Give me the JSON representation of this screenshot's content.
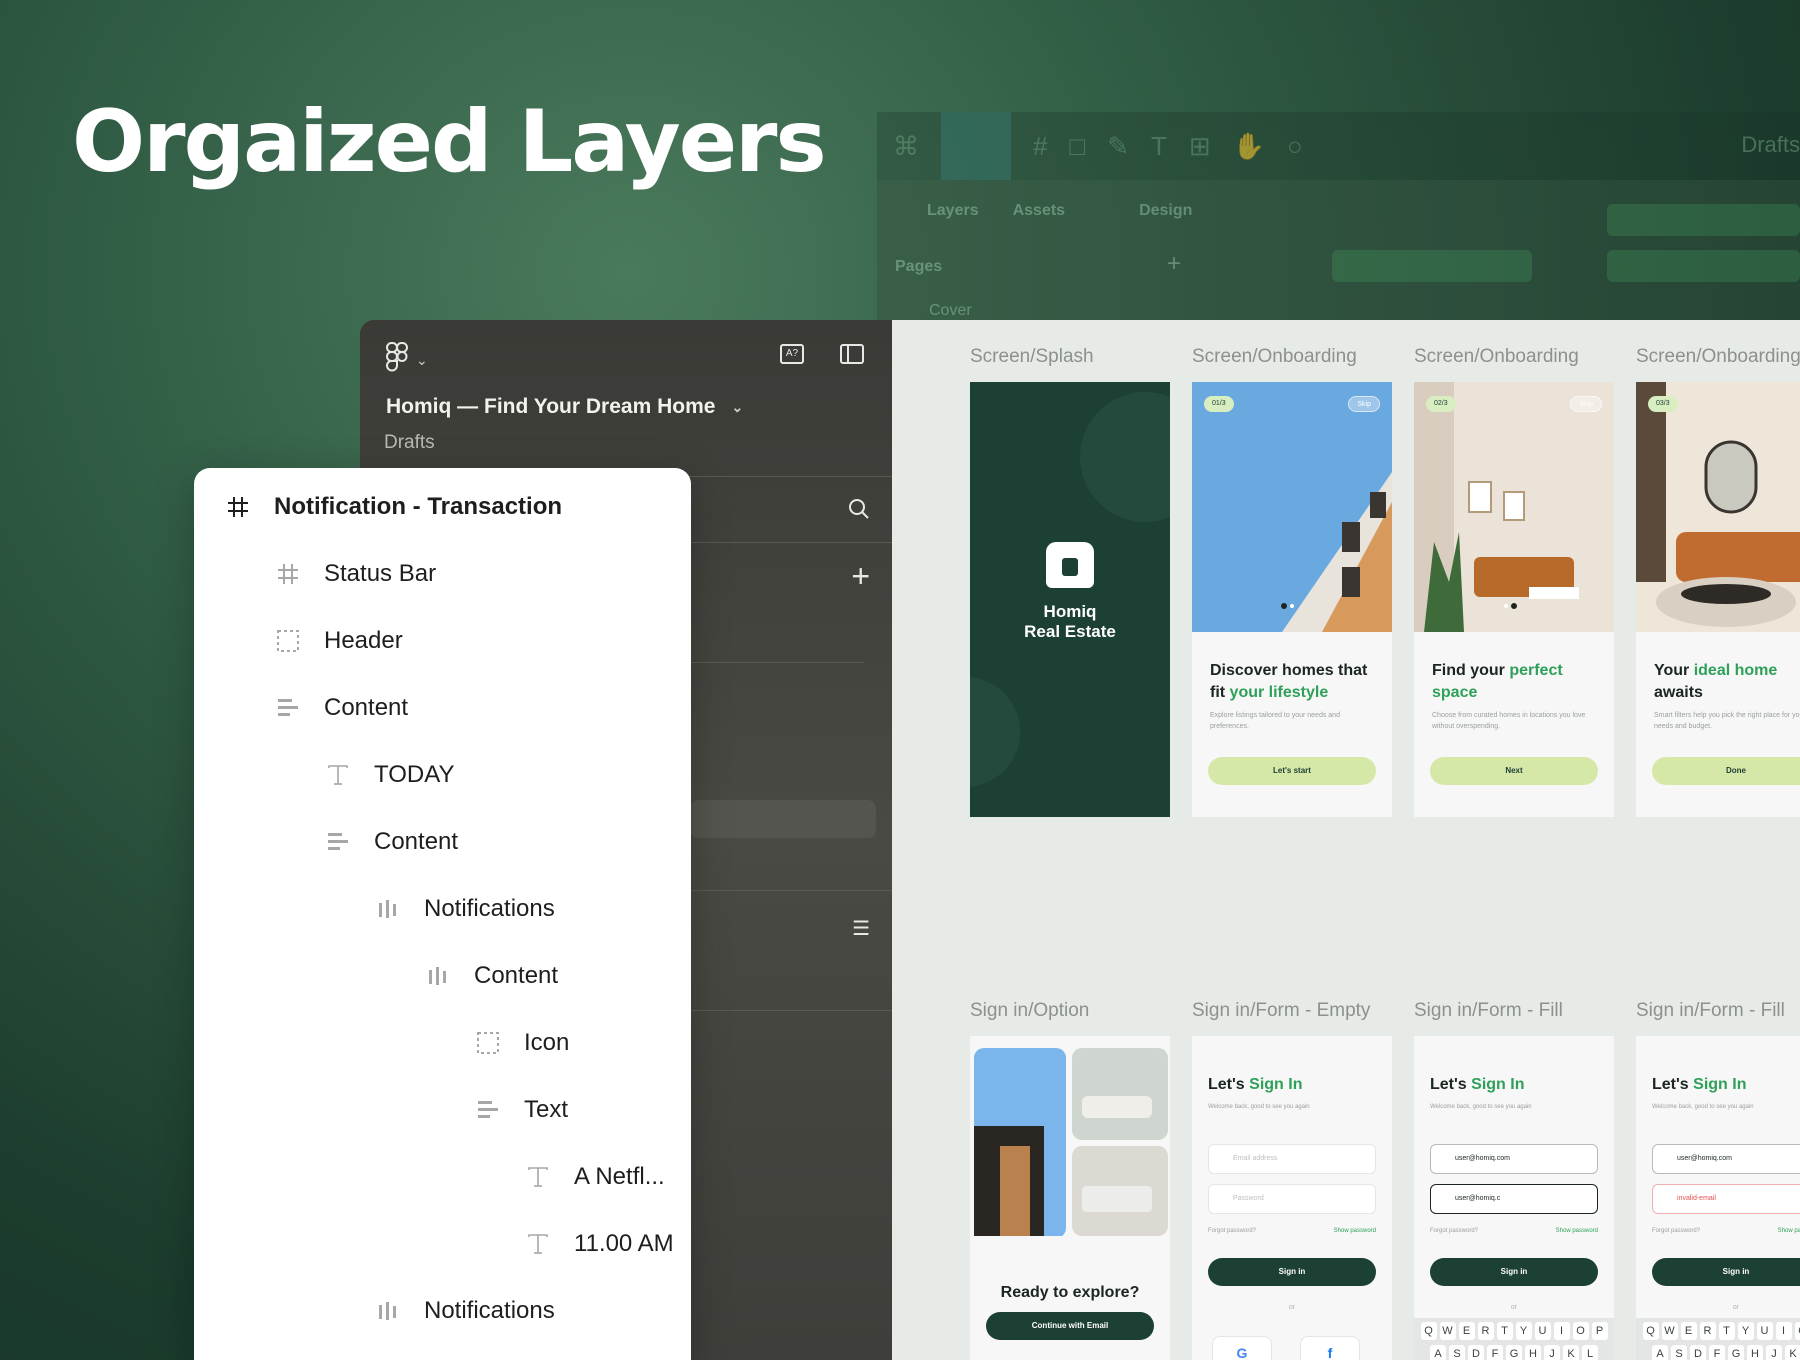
{
  "hero": {
    "title": "Orgaized Layers"
  },
  "background_ui": {
    "tabs": [
      "Layers",
      "Assets",
      "Design"
    ],
    "pages_label": "Pages",
    "cover_label": "Cover",
    "drafts_label": "Drafts"
  },
  "figma_panel": {
    "file_title": "Homiq — Find Your Dream Home",
    "location": "Drafts"
  },
  "layers_panel": {
    "items": [
      {
        "label": "Notification - Transaction",
        "icon": "frame-icon",
        "depth": 0
      },
      {
        "label": "Status Bar",
        "icon": "frame-icon",
        "depth": 1
      },
      {
        "label": "Header",
        "icon": "group-icon",
        "depth": 1
      },
      {
        "label": "Content",
        "icon": "vertical-stack-icon",
        "depth": 1
      },
      {
        "label": "TODAY",
        "icon": "text-icon",
        "depth": 2
      },
      {
        "label": "Content",
        "icon": "vertical-stack-icon",
        "depth": 2
      },
      {
        "label": "Notifications",
        "icon": "horizontal-stack-icon",
        "depth": 3
      },
      {
        "label": "Content",
        "icon": "horizontal-stack-icon",
        "depth": 4
      },
      {
        "label": "Icon",
        "icon": "group-icon",
        "depth": 5
      },
      {
        "label": "Text",
        "icon": "vertical-stack-icon",
        "depth": 5
      },
      {
        "label": "A Netfl...",
        "icon": "text-icon",
        "depth": 6
      },
      {
        "label": "11.00 AM",
        "icon": "text-icon",
        "depth": 6
      },
      {
        "label": "Notifications",
        "icon": "horizontal-stack-icon",
        "depth": 3
      }
    ]
  },
  "canvas": {
    "frame_labels": [
      "Screen/Splash",
      "Screen/Onboarding",
      "Screen/Onboarding",
      "Screen/Onboarding",
      "Sign in/Option",
      "Sign in/Form - Empty",
      "Sign in/Form - Fill",
      "Sign in/Form - Fill"
    ],
    "splash": {
      "name_line1": "Homiq",
      "name_line2": "Real Estate"
    },
    "onboarding": [
      {
        "step": "01/3",
        "skip": "Skip",
        "head_a": "Discover homes that fit ",
        "head_hl": "your lifestyle",
        "head_b": "",
        "sub": "Explore listings tailored to your needs and preferences.",
        "button": "Let's start"
      },
      {
        "step": "02/3",
        "skip": "Skip",
        "head_a": "Find your ",
        "head_hl": "perfect space",
        "head_b": "",
        "sub": "Choose from curated homes in locations you love without overspending.",
        "button": "Next"
      },
      {
        "step": "03/3",
        "skip": "",
        "head_a": "Your ",
        "head_hl": "ideal home",
        "head_b": " awaits",
        "sub": "Smart filters help you pick the right place for your needs and budget.",
        "button": "Done"
      }
    ],
    "option": {
      "ready": "Ready to explore?",
      "button": "Continue with Email"
    },
    "signin": {
      "head_a": "Let's ",
      "head_hl": "Sign In",
      "sub": "Welcome back, good to see you again",
      "email_placeholder": "Email address",
      "password_placeholder": "Password",
      "email_value": "user@homiq.com",
      "password_value": "user@homiq.c",
      "error_value": "invalid-email",
      "forgot": "Forgot password?",
      "show": "Show password",
      "button": "Sign in",
      "or": "or",
      "keys_row1": [
        "Q",
        "W",
        "E",
        "R",
        "T",
        "Y",
        "U",
        "I",
        "O",
        "P"
      ],
      "keys_row2": [
        "A",
        "S",
        "D",
        "F",
        "G",
        "H",
        "J",
        "K",
        "L"
      ],
      "social": [
        "G",
        "f"
      ]
    }
  }
}
